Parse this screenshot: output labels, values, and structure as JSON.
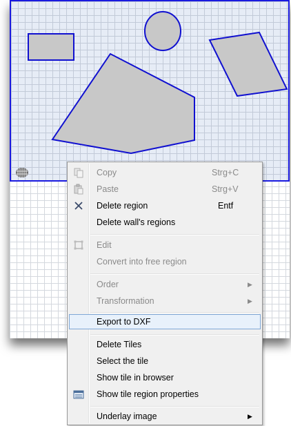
{
  "colors": {
    "tile_border": "#1a1adf",
    "tile_fill": "#e6ecf6",
    "shape_fill": "#c8c8c8",
    "shape_stroke": "#1010d0",
    "menu_bg": "#f0f0f0",
    "highlight_bg": "#e8f1fb",
    "highlight_border": "#7ea7d6"
  },
  "canvas": {
    "tile_icon": "tile-grid-icon",
    "shapes": [
      "rectangle-region",
      "ellipse-region",
      "polygon-region",
      "parallelogram-region"
    ]
  },
  "menu": {
    "items": [
      {
        "label": "Copy",
        "shortcut": "Strg+C",
        "disabled": true,
        "icon": "copy-icon"
      },
      {
        "label": "Paste",
        "shortcut": "Strg+V",
        "disabled": true,
        "icon": "paste-icon"
      },
      {
        "label": "Delete region",
        "shortcut": "Entf",
        "disabled": false,
        "icon": "delete-x-icon"
      },
      {
        "label": "Delete wall's regions",
        "shortcut": "",
        "disabled": false
      },
      {
        "label": "Edit",
        "shortcut": "",
        "disabled": true,
        "icon": "edit-region-icon"
      },
      {
        "label": "Convert into free region",
        "shortcut": "",
        "disabled": true
      },
      {
        "label": "Order",
        "shortcut": "",
        "disabled": true,
        "submenu": true
      },
      {
        "label": "Transformation",
        "shortcut": "",
        "disabled": true,
        "submenu": true
      },
      {
        "label": "Export to DXF",
        "shortcut": "",
        "disabled": false,
        "highlighted": true
      },
      {
        "label": "Delete Tiles",
        "shortcut": "",
        "disabled": false
      },
      {
        "label": "Select the tile",
        "shortcut": "",
        "disabled": false
      },
      {
        "label": "Show tile in browser",
        "shortcut": "",
        "disabled": false
      },
      {
        "label": "Show tile region properties",
        "shortcut": "",
        "disabled": false,
        "icon": "properties-icon"
      },
      {
        "label": "Underlay image",
        "shortcut": "",
        "disabled": false,
        "submenu": true
      }
    ]
  }
}
